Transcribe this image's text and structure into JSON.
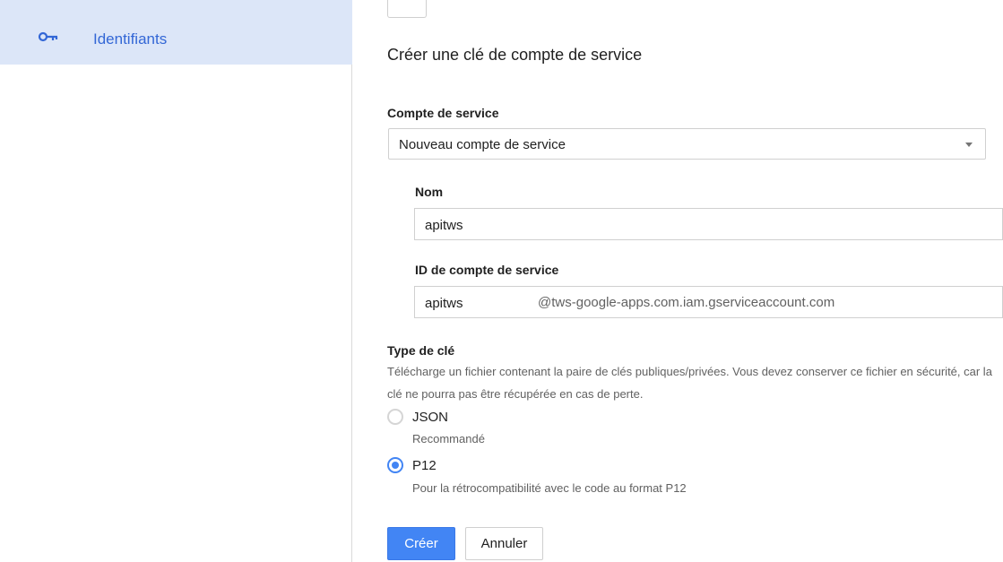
{
  "sidebar": {
    "items": [
      {
        "label": "Identifiants",
        "icon": "key-icon",
        "active": true
      }
    ]
  },
  "form": {
    "title": "Créer une clé de compte de service",
    "service_account": {
      "label": "Compte de service",
      "selected": "Nouveau compte de service"
    },
    "name": {
      "label": "Nom",
      "value": "apitws"
    },
    "service_account_id": {
      "label": "ID de compte de service",
      "value": "apitws",
      "suffix": "@tws-google-apps.com.iam.gserviceaccount.com"
    },
    "key_type": {
      "title": "Type de clé",
      "description": "Télécharge un fichier contenant la paire de clés publiques/privées. Vous devez conserver ce fichier en sécurité, car la clé ne pourra pas être récupérée en cas de perte.",
      "options": [
        {
          "label": "JSON",
          "sublabel": "Recommandé",
          "checked": false
        },
        {
          "label": "P12",
          "sublabel": "Pour la rétrocompatibilité avec le code au format P12",
          "checked": true
        }
      ]
    },
    "buttons": {
      "create": "Créer",
      "cancel": "Annuler"
    }
  },
  "colors": {
    "accent": "#4285f4",
    "sidebar_active_bg": "#dce6f8",
    "sidebar_active_text": "#3367d6"
  }
}
